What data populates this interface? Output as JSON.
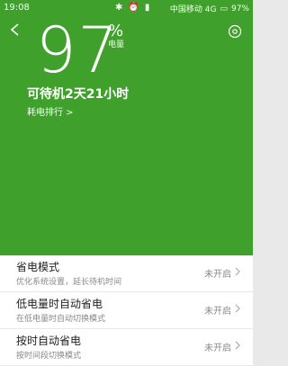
{
  "status_bar": {
    "time": "19:08",
    "carrier": "中国移动 4G",
    "battery_text": "97%"
  },
  "battery": {
    "value": "97",
    "unit": "%",
    "unit_label": "电量"
  },
  "standby": "可待机2天21小时",
  "power_rank_link": "耗电排行 >",
  "settings": [
    {
      "title": "省电模式",
      "subtitle": "优化系统设置，延长待机时间",
      "state": "未开启"
    },
    {
      "title": "低电量时自动省电",
      "subtitle": "在低电量时自动切换模式",
      "state": "未开启"
    },
    {
      "title": "按时自动省电",
      "subtitle": "按时间段切换模式",
      "state": "未开启"
    }
  ],
  "colors": {
    "accent": "#3fa12c"
  }
}
